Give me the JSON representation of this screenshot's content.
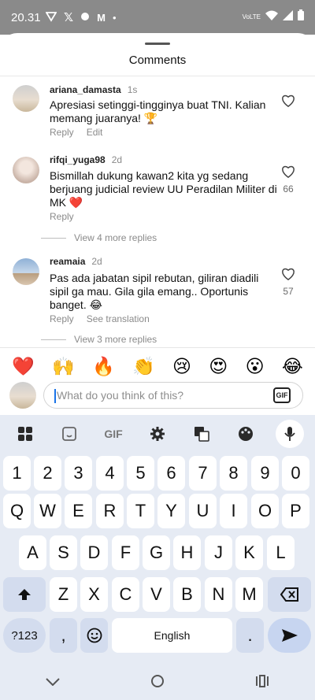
{
  "status": {
    "time": "20.31",
    "network": "VoLTE"
  },
  "sheet": {
    "title": "Comments"
  },
  "comments": [
    {
      "user": "ariana_damasta",
      "time": "1s",
      "text": "Apresiasi setinggi-tingginya buat TNI. Kalian memang juaranya! 🏆",
      "reply": "Reply",
      "extra": "Edit",
      "likes": ""
    },
    {
      "user": "rifqi_yuga98",
      "time": "2d",
      "text": "Bismillah dukung kawan2 kita yg sedang berjuang judicial review UU Peradilan Militer di MK ❤️",
      "reply": "Reply",
      "extra": "",
      "likes": "66",
      "more_replies": "View 4 more replies"
    },
    {
      "user": "reamaia",
      "time": "2d",
      "text": "Pas ada jabatan sipil rebutan, giliran diadili sipil ga mau. Gila gila emang.. Oportunis banget. 😂",
      "reply": "Reply",
      "extra": "See translation",
      "likes": "57",
      "more_replies": "View 3 more replies"
    }
  ],
  "emojis": [
    "❤️",
    "🙌",
    "🔥",
    "👏",
    "😢",
    "😍",
    "😮",
    "😂"
  ],
  "composer": {
    "placeholder": "What do you think of this?",
    "gif_label": "GIF"
  },
  "keyboard": {
    "toolbar_gif": "GIF",
    "numbers": [
      "1",
      "2",
      "3",
      "4",
      "5",
      "6",
      "7",
      "8",
      "9",
      "0"
    ],
    "row1": [
      "Q",
      "W",
      "E",
      "R",
      "T",
      "Y",
      "U",
      "I",
      "O",
      "P"
    ],
    "row2": [
      "A",
      "S",
      "D",
      "F",
      "G",
      "H",
      "J",
      "K",
      "L"
    ],
    "row3": [
      "Z",
      "X",
      "C",
      "V",
      "B",
      "N",
      "M"
    ],
    "symbols_label": "?123",
    "comma": ",",
    "space_label": "English",
    "period": "."
  },
  "colors": {
    "accent": "#1a73e8",
    "heart": "#e0245e",
    "keyboard_bg": "#e6ebf4"
  }
}
